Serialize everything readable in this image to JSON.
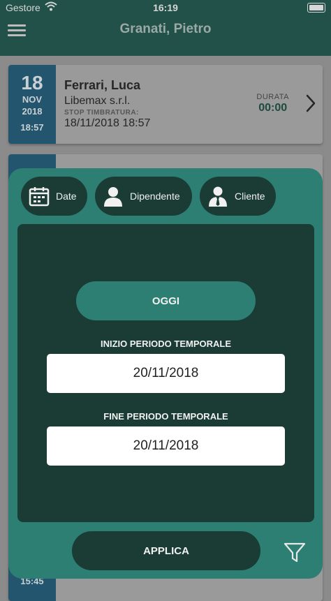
{
  "status_bar": {
    "carrier": "Gestore",
    "time": "16:19"
  },
  "header": {
    "title": "Granati, Pietro"
  },
  "entries": [
    {
      "day": "18",
      "month": "NOV",
      "year": "2018",
      "time": "18:57",
      "name": "Ferrari, Luca",
      "company": "Libemax s.r.l.",
      "stop_label": "STOP TIMBRATURA:",
      "stop_value": "18/11/2018 18:57",
      "duration_label": "DURATA",
      "duration_value": "00:00"
    }
  ],
  "bottom_entry": {
    "time": "15:45"
  },
  "filter": {
    "tabs": [
      {
        "label": "Date",
        "icon": "calendar-icon"
      },
      {
        "label": "Dipendente",
        "icon": "person-icon"
      },
      {
        "label": "Cliente",
        "icon": "person-tie-icon"
      }
    ],
    "today_label": "OGGI",
    "start_label": "INIZIO PERIODO TEMPORALE",
    "start_value": "20/11/2018",
    "end_label": "FINE PERIODO TEMPORALE",
    "end_value": "20/11/2018",
    "apply_label": "APPLICA",
    "filter_icon": "filter-icon"
  },
  "colors": {
    "header_bg": "#22514a",
    "modal_bg": "#2d7f74",
    "panel_bg": "#1a3c35",
    "date_col_bg": "#23566e"
  }
}
